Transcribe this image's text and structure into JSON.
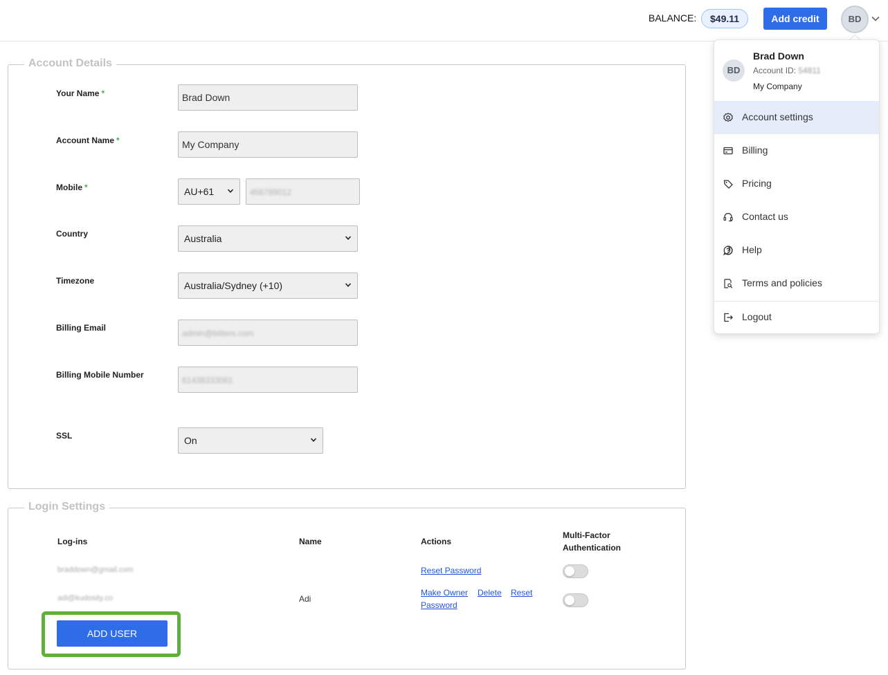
{
  "header": {
    "balance_label": "BALANCE:",
    "balance_value": "$49.11",
    "add_credit_label": "Add credit",
    "avatar_initials": "BD"
  },
  "account_details": {
    "legend": "Account Details",
    "fields": {
      "your_name": {
        "label": "Your Name",
        "value": "Brad Down"
      },
      "account_name": {
        "label": "Account Name",
        "value": "My Company"
      },
      "mobile": {
        "label": "Mobile",
        "country_code": "AU+61",
        "number": "456789012"
      },
      "country": {
        "label": "Country",
        "value": "Australia"
      },
      "timezone": {
        "label": "Timezone",
        "value": "Australia/Sydney (+10)"
      },
      "billing_email": {
        "label": "Billing Email",
        "value": "admin@bitters.com"
      },
      "billing_mobile": {
        "label": "Billing Mobile Number",
        "value": "61438333061"
      },
      "ssl": {
        "label": "SSL",
        "value": "On"
      }
    },
    "required_mark": "*"
  },
  "login_settings": {
    "legend": "Login Settings",
    "columns": {
      "logins": "Log-ins",
      "name": "Name",
      "actions": "Actions",
      "mfa_line1": "Multi-Factor",
      "mfa_line2": "Authentication"
    },
    "rows": [
      {
        "login": "braddown@gmail.com",
        "name": "",
        "reset": "Reset Password"
      },
      {
        "login": "adi@kudosity.co",
        "name": "Adi",
        "make_owner": "Make Owner",
        "delete": "Delete",
        "reset1": "Reset",
        "reset2": "Password"
      }
    ],
    "add_user_label": "ADD USER"
  },
  "menu": {
    "avatar_initials": "BD",
    "user_name": "Brad Down",
    "account_id_label": "Account ID:",
    "account_id_value": "54811",
    "company": "My Company",
    "items": [
      {
        "label": "Account settings",
        "icon": "gear-icon"
      },
      {
        "label": "Billing",
        "icon": "card-icon"
      },
      {
        "label": "Pricing",
        "icon": "tag-icon"
      },
      {
        "label": "Contact us",
        "icon": "headset-icon"
      },
      {
        "label": "Help",
        "icon": "help-icon"
      },
      {
        "label": "Terms and policies",
        "icon": "document-search-icon"
      },
      {
        "label": "Logout",
        "icon": "logout-icon"
      }
    ]
  },
  "colors": {
    "primary": "#2f6de8",
    "highlight_border": "#5fb03b",
    "required": "#4caf50",
    "link": "#2553d8"
  }
}
